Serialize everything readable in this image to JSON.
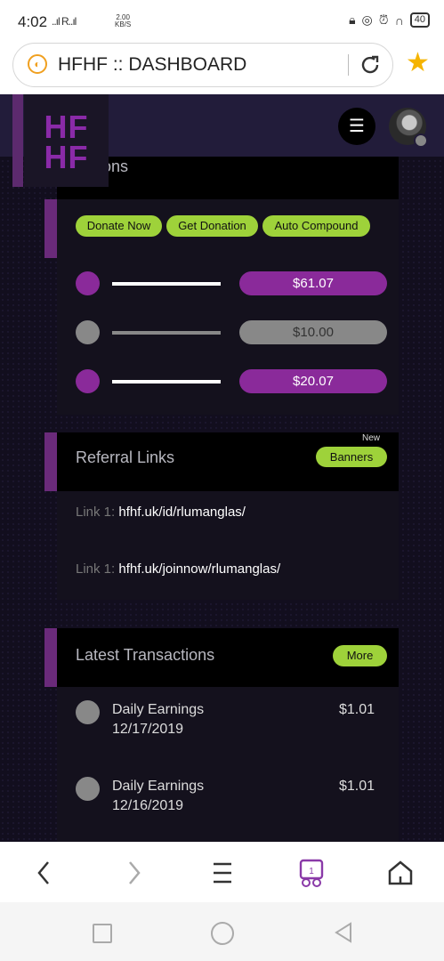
{
  "status_bar": {
    "time": "4:02",
    "signal": "..ıl R..ıl",
    "speed_value": "2.00",
    "speed_unit": "KB/S",
    "battery": "40"
  },
  "browser": {
    "url_text": "HFHF :: DASHBOARD"
  },
  "site": {
    "logo_line1": "HF",
    "logo_line2": "HF",
    "menu_icon": "☰"
  },
  "actions": {
    "title": "Actions",
    "buttons": [
      "Donate Now",
      "Get Donation",
      "Auto Compound"
    ],
    "rows": [
      {
        "amount": "$61.07",
        "color": "#8a2a9a"
      },
      {
        "amount": "$10.00",
        "color": "#8a8a8a"
      },
      {
        "amount": "$20.07",
        "color": "#8a2a9a"
      }
    ]
  },
  "referral": {
    "title": "Referral Links",
    "new_badge": "New",
    "banners_label": "Banners",
    "links": [
      {
        "label": "Link 1:",
        "url": "hfhf.uk/id/rlumanglas/"
      },
      {
        "label": "Link 1:",
        "url": "hfhf.uk/joinnow/rlumanglas/"
      }
    ]
  },
  "transactions": {
    "title": "Latest Transactions",
    "more_label": "More",
    "items": [
      {
        "desc": "Daily Earnings",
        "date": "12/17/2019",
        "amount": "$1.01"
      },
      {
        "desc": "Daily Earnings",
        "date": "12/16/2019",
        "amount": "$1.01"
      }
    ]
  },
  "toolbar": {
    "tab_count": "1"
  },
  "colors": {
    "accent_purple": "#8a2a9a",
    "accent_green": "#9ed23a",
    "logo_purple": "#8a2aa8"
  }
}
